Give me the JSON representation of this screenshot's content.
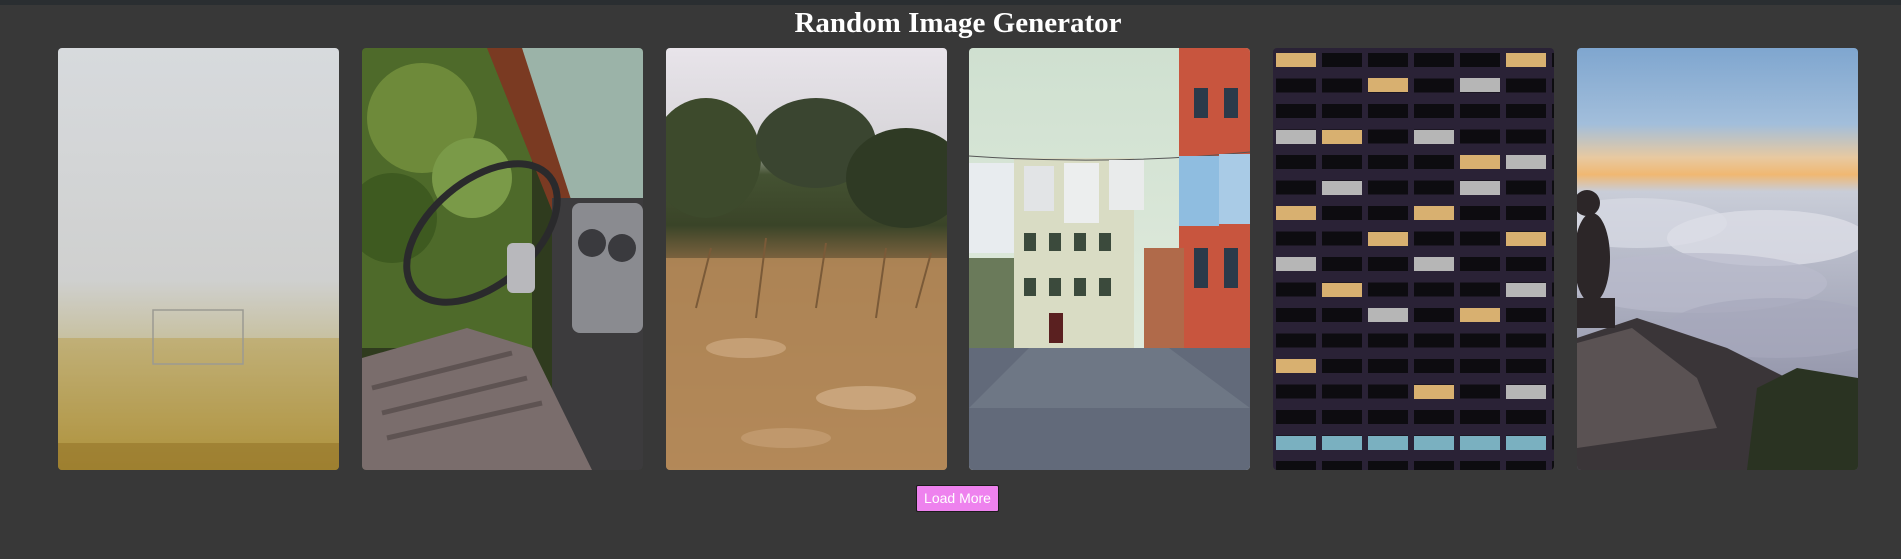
{
  "header": {
    "title": "Random Image Generator"
  },
  "gallery": {
    "images": [
      {
        "subject": "foggy football field with goal"
      },
      {
        "subject": "abandoned truck interior with steering wheel"
      },
      {
        "subject": "dry grass field with trees"
      },
      {
        "subject": "street with laundry lines and colorful buildings"
      },
      {
        "subject": "high-rise building windows at night"
      },
      {
        "subject": "person sitting on rock above sea of clouds"
      }
    ]
  },
  "actions": {
    "load_more_label": "Load More"
  },
  "colors": {
    "background": "#383838",
    "topbar": "#2a2e31",
    "button": "#ee82ee"
  }
}
